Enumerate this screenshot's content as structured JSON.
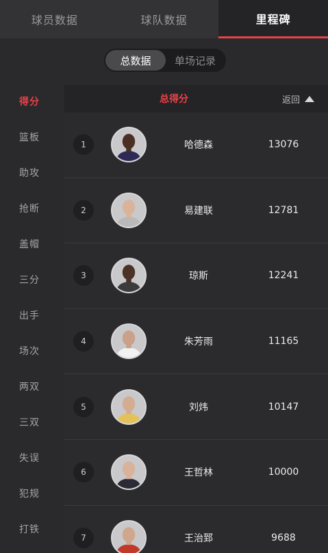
{
  "top_tabs": [
    {
      "label": "球员数据",
      "active": false
    },
    {
      "label": "球队数据",
      "active": false
    },
    {
      "label": "里程碑",
      "active": true
    }
  ],
  "segment": {
    "active": "总数据",
    "inactive": "单场记录"
  },
  "sidebar": {
    "items": [
      "得分",
      "篮板",
      "助攻",
      "抢断",
      "盖帽",
      "三分",
      "出手",
      "场次",
      "两双",
      "三双",
      "失误",
      "犯规",
      "打铁"
    ],
    "active_index": 0
  },
  "table": {
    "header": "总得分",
    "back_label": "返回",
    "rows": [
      {
        "rank": "1",
        "name": "哈德森",
        "value": "13076",
        "skin": "#4a2f22",
        "jersey": "#2f2a55"
      },
      {
        "rank": "2",
        "name": "易建联",
        "value": "12781",
        "skin": "#d9b49a",
        "jersey": "#b9b9b9"
      },
      {
        "rank": "3",
        "name": "琼斯",
        "value": "12241",
        "skin": "#4b3226",
        "jersey": "#3b3b3b"
      },
      {
        "rank": "4",
        "name": "朱芳雨",
        "value": "11165",
        "skin": "#c9a088",
        "jersey": "#f2f2f2"
      },
      {
        "rank": "5",
        "name": "刘炜",
        "value": "10147",
        "skin": "#d4ac92",
        "jersey": "#e4c25a"
      },
      {
        "rank": "6",
        "name": "王哲林",
        "value": "10000",
        "skin": "#d8b29a",
        "jersey": "#2b2b35"
      },
      {
        "rank": "7",
        "name": "王治郅",
        "value": "9688",
        "skin": "#cfa68e",
        "jersey": "#c0392b"
      }
    ]
  },
  "colors": {
    "accent": "#e8424a",
    "background": "#2a2a2c",
    "avatar_bg": "#c9c9cb"
  }
}
